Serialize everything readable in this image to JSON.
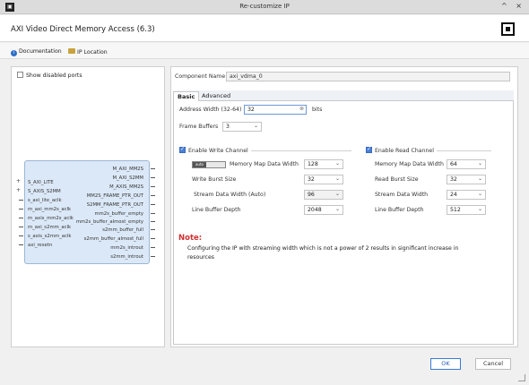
{
  "window": {
    "title": "Re-customize IP",
    "minimize_glyph": "^",
    "close_glyph": "×"
  },
  "header": {
    "ip_name": "AXI Video Direct Memory Access (6.3)"
  },
  "docbar": {
    "documentation": "Documentation",
    "ip_location": "IP Location"
  },
  "left": {
    "show_disabled_ports": "Show disabled ports",
    "ports_left": [
      "S_AXI_LITE",
      "S_AXIS_S2MM",
      "s_axi_lite_aclk",
      "m_axi_mm2s_aclk",
      "m_axis_mm2s_aclk",
      "m_axi_s2mm_aclk",
      "s_axis_s2mm_aclk",
      "axi_resetn"
    ],
    "ports_right": [
      "M_AXI_MM2S",
      "M_AXI_S2MM",
      "M_AXIS_MM2S",
      "MM2S_FRAME_PTR_OUT",
      "S2MM_FRAME_PTR_OUT",
      "mm2s_buffer_empty",
      "mm2s_buffer_almost_empty",
      "s2mm_buffer_full",
      "s2mm_buffer_almost_full",
      "mm2s_introut",
      "s2mm_introut"
    ]
  },
  "component": {
    "label": "Component Name",
    "value": "axi_vdma_0"
  },
  "tabs": {
    "basic": "Basic",
    "advanced": "Advanced"
  },
  "basic": {
    "address_width_label": "Address Width (32-64)",
    "address_width_value": "32",
    "address_width_unit": "bits",
    "frame_buffers_label": "Frame Buffers",
    "frame_buffers_value": "3",
    "write_channel": {
      "title": "Enable Write Channel",
      "toggle_text": "auto",
      "mm_width_label": "Memory Map Data Width",
      "mm_width_value": "128",
      "burst_label": "Write Burst Size",
      "burst_value": "32",
      "stream_label": "Stream Data Width (Auto)",
      "stream_value": "96",
      "line_buffer_label": "Line Buffer Depth",
      "line_buffer_value": "2048"
    },
    "read_channel": {
      "title": "Enable Read Channel",
      "mm_width_label": "Memory Map Data Width",
      "mm_width_value": "64",
      "burst_label": "Read Burst Size",
      "burst_value": "32",
      "stream_label": "Stream Data Width",
      "stream_value": "24",
      "line_buffer_label": "Line Buffer Depth",
      "line_buffer_value": "512"
    },
    "note_title": "Note:",
    "note_text": "Configuring the IP with streaming width which is not a power of 2 results in significant increase in resources"
  },
  "footer": {
    "ok": "OK",
    "cancel": "Cancel"
  },
  "colors": {
    "accent": "#3a7ad6",
    "note_red": "#d03030",
    "ip_block": "#dbe8f7"
  }
}
